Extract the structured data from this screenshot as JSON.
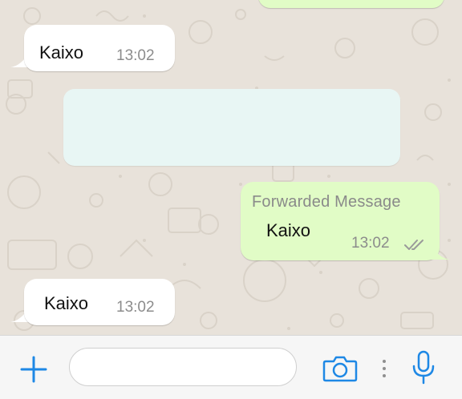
{
  "messages": [
    {
      "type": "incoming",
      "text": "Kaixo",
      "time": "13:02"
    },
    {
      "type": "outgoing",
      "forwarded_label": "Forwarded Message",
      "text": "Kaixo",
      "time": "13:02",
      "status": "read-double-check"
    },
    {
      "type": "incoming",
      "text": "Kaixo",
      "time": "13:02"
    }
  ],
  "composer": {
    "placeholder": "",
    "icons": {
      "attach": "plus-icon",
      "camera": "camera-icon",
      "more": "vertical-dots-icon",
      "voice": "microphone-icon"
    }
  },
  "colors": {
    "background": "#e8e2da",
    "incoming_bubble": "#ffffff",
    "outgoing_bubble": "#e1fcc6",
    "accent": "#1e88e5",
    "tick_gray": "#9a9a9a"
  }
}
